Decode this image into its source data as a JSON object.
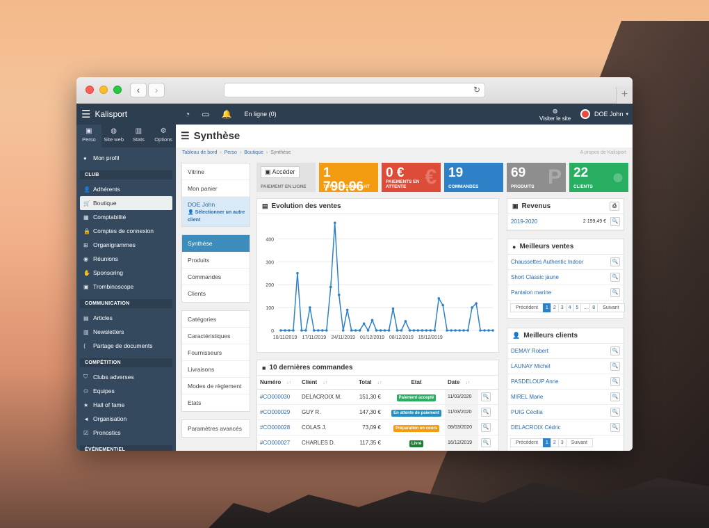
{
  "app": {
    "name": "Kalisport"
  },
  "topbar": {
    "online": "En ligne (0)",
    "visit": "Visiter le site",
    "user": "DOE John"
  },
  "sidebar": {
    "tabs": [
      {
        "label": "Perso",
        "icon": "user-card-icon"
      },
      {
        "label": "Site web",
        "icon": "globe-icon"
      },
      {
        "label": "Stats",
        "icon": "chart-icon"
      },
      {
        "label": "Options",
        "icon": "gears-icon"
      }
    ],
    "profile": "Mon profil",
    "sections": [
      {
        "title": "CLUB",
        "items": [
          "Adhérents",
          "Boutique",
          "Comptabilité",
          "Comptes de connexion",
          "Organigrammes",
          "Réunions",
          "Sponsoring",
          "Trombinoscope"
        ]
      },
      {
        "title": "COMMUNICATION",
        "items": [
          "Articles",
          "Newsletters",
          "Partage de documents"
        ]
      },
      {
        "title": "COMPÉTITION",
        "items": [
          "Clubs adverses",
          "Equipes",
          "Hall of fame",
          "Organisation",
          "Pronostics"
        ]
      },
      {
        "title": "ÉVÉNEMENTIEL",
        "items": []
      }
    ]
  },
  "page": {
    "title": "Synthèse",
    "breadcrumb": [
      "Tableau de bord",
      "Perso",
      "Boutique",
      "Synthèse"
    ],
    "about": "A propos de Kalisport"
  },
  "submenu": {
    "block1": [
      "Vitrine",
      "Mon panier"
    ],
    "user_name": "DOE John",
    "user_action": "Sélectionner un autre client",
    "block2": [
      "Synthèse",
      "Produits",
      "Commandes",
      "Clients"
    ],
    "block3": [
      "Catégories",
      "Caractéristiques",
      "Fournisseurs",
      "Livraisons",
      "Modes de règlement",
      "Etats"
    ],
    "block4": [
      "Paramètres avancés"
    ]
  },
  "tiles": {
    "access": {
      "button": "Accéder",
      "label": "PAIEMENT EN LIGNE"
    },
    "revenue": {
      "value": "1 790,96 €",
      "label": "TOTAL PRODUITS HT"
    },
    "pending": {
      "value": "0 €",
      "label": "PAIEMENTS EN ATTENTE"
    },
    "orders": {
      "value": "19",
      "label": "COMMANDES"
    },
    "products": {
      "value": "69",
      "label": "PRODUITS"
    },
    "clients": {
      "value": "22",
      "label": "CLIENTS"
    }
  },
  "sales": {
    "title": "Evolution des ventes"
  },
  "chart_data": {
    "type": "line",
    "x_ticks": [
      "10/11/2019",
      "17/11/2019",
      "24/11/2019",
      "01/12/2019",
      "08/12/2019",
      "15/12/2019"
    ],
    "y_ticks": [
      0,
      100,
      200,
      300,
      400
    ],
    "ylim": [
      0,
      480
    ],
    "values": [
      0,
      0,
      0,
      0,
      250,
      0,
      0,
      100,
      0,
      0,
      0,
      0,
      190,
      470,
      155,
      0,
      90,
      0,
      0,
      0,
      30,
      0,
      45,
      0,
      0,
      0,
      0,
      95,
      0,
      0,
      40,
      0,
      0,
      0,
      0,
      0,
      0,
      0,
      140,
      110,
      0,
      0,
      0,
      0,
      0,
      0,
      100,
      118,
      0,
      0,
      0,
      0
    ],
    "color": "#2f81c7"
  },
  "orders": {
    "title": "10 dernières commandes",
    "headers": [
      "Numéro",
      "Client",
      "Total",
      "Etat",
      "Date"
    ],
    "rows": [
      {
        "num": "#CO000030",
        "client": "DELACROIX M.",
        "total": "151,30 €",
        "state": "Paiement accepté",
        "state_color": "#27ae60",
        "date": "11/03/2020"
      },
      {
        "num": "#CO000029",
        "client": "GUY R.",
        "total": "147,30 €",
        "state": "En attente de paiement",
        "state_color": "#1f8fc4",
        "date": "11/03/2020"
      },
      {
        "num": "#CO000028",
        "client": "COLAS J.",
        "total": "73,09 €",
        "state": "Préparation en cours",
        "state_color": "#f39c12",
        "date": "08/03/2020"
      },
      {
        "num": "#CO000027",
        "client": "CHARLES D.",
        "total": "117,35 €",
        "state": "Livré",
        "state_color": "#1e7e34",
        "date": "16/12/2019"
      }
    ]
  },
  "revenue_panel": {
    "title": "Revenus",
    "period": "2019-2020",
    "amount": "2 199,49 €"
  },
  "best_sales": {
    "title": "Meilleurs ventes",
    "items": [
      "Chaussettes Authentic Indoor",
      "Short Classic jaune",
      "Pantalon marine"
    ],
    "pager": [
      "Précédent",
      "1",
      "2",
      "3",
      "4",
      "5",
      "...",
      "8",
      "Suivant"
    ]
  },
  "best_clients": {
    "title": "Meilleurs clients",
    "items": [
      "DEMAY Robert",
      "LAUNAY Michel",
      "PASDELOUP Anne",
      "MIREL Marie",
      "PUIG Cécilia",
      "DELACROIX Cédric"
    ],
    "pager": [
      "Précédent",
      "1",
      "2",
      "3",
      "Suivant"
    ]
  }
}
